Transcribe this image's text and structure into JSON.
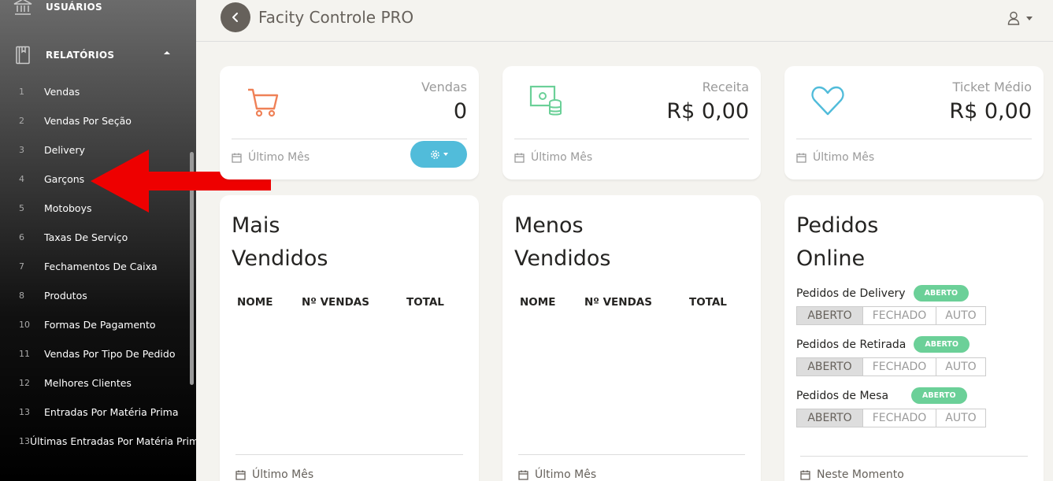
{
  "sidebar": {
    "section_users": "USUÁRIOS",
    "section_reports": "RELATÓRIOS",
    "reports": [
      {
        "num": "1",
        "label": "Vendas"
      },
      {
        "num": "2",
        "label": "Vendas Por Seção"
      },
      {
        "num": "3",
        "label": "Delivery"
      },
      {
        "num": "4",
        "label": "Garçons"
      },
      {
        "num": "5",
        "label": "Motoboys"
      },
      {
        "num": "6",
        "label": "Taxas De Serviço"
      },
      {
        "num": "7",
        "label": "Fechamentos De Caixa"
      },
      {
        "num": "8",
        "label": "Produtos"
      },
      {
        "num": "10",
        "label": "Formas De Pagamento"
      },
      {
        "num": "11",
        "label": "Vendas Por Tipo De Pedido"
      },
      {
        "num": "12",
        "label": "Melhores Clientes"
      },
      {
        "num": "13",
        "label": "Entradas Por Matéria Prima"
      },
      {
        "num": "13",
        "label": "Últimas Entradas Por Matéria Prima"
      }
    ]
  },
  "header": {
    "title": "Facity Controle PRO"
  },
  "stats": [
    {
      "label": "Vendas",
      "value": "0",
      "footer": "Último Mês",
      "icon": "cart-icon",
      "color": "#ef8157"
    },
    {
      "label": "Receita",
      "value": "R$ 0,00",
      "footer": "Último Mês",
      "icon": "money-icon",
      "color": "#6bd098"
    },
    {
      "label": "Ticket Médio",
      "value": "R$ 0,00",
      "footer": "Último Mês",
      "icon": "heart-icon",
      "color": "#51bcda"
    }
  ],
  "best_sellers": {
    "title_line1": "Mais",
    "title_line2": "Vendidos",
    "columns": [
      "NOME",
      "Nº VENDAS",
      "TOTAL"
    ],
    "footer": "Último Mês"
  },
  "worst_sellers": {
    "title_line1": "Menos",
    "title_line2": "Vendidos",
    "columns": [
      "NOME",
      "Nº VENDAS",
      "TOTAL"
    ],
    "footer": "Último Mês"
  },
  "online_orders": {
    "title_line1": "Pedidos",
    "title_line2": "Online",
    "rows": [
      {
        "label": "Pedidos de Delivery",
        "status": "ABERTO"
      },
      {
        "label": "Pedidos de Retirada",
        "status": "ABERTO"
      },
      {
        "label": "Pedidos de Mesa",
        "status": "ABERTO"
      }
    ],
    "options": [
      "ABERTO",
      "FECHADO",
      "AUTO"
    ],
    "selected": "ABERTO",
    "footer": "Neste Momento"
  }
}
